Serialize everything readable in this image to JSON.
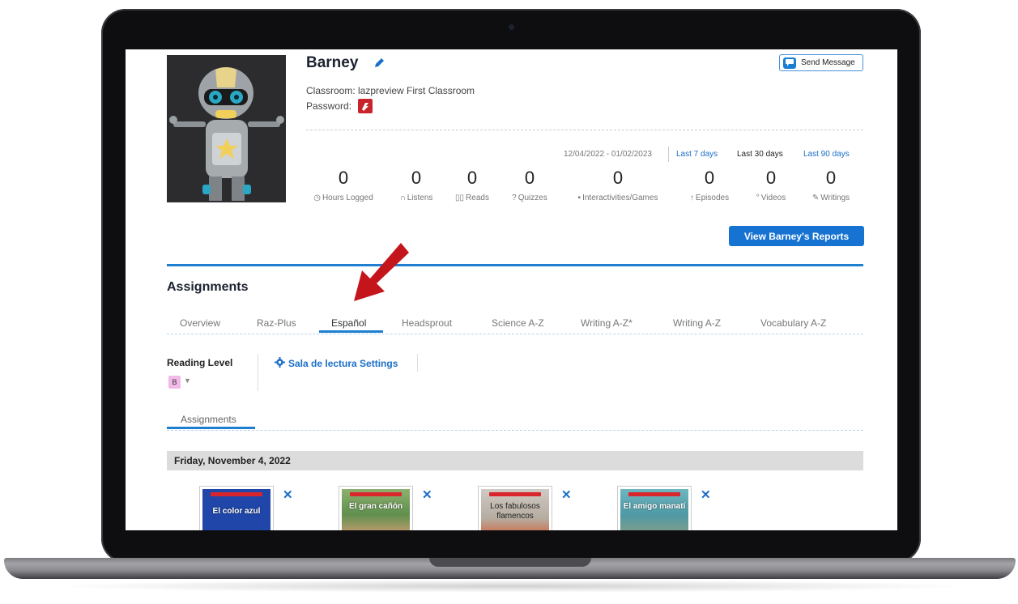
{
  "student": {
    "name": "Barney",
    "classroom": "Classroom: lazpreview First Classroom",
    "password_label": "Password:"
  },
  "send_message_label": "Send Message",
  "date_range": "12/04/2022 - 01/02/2023",
  "ranges": [
    "Last 7 days",
    "Last 30 days",
    "Last 90 days"
  ],
  "selected_range": "Last 30 days",
  "stats": [
    {
      "value": "0",
      "label": "Hours Logged",
      "icon": "clock-icon"
    },
    {
      "value": "0",
      "label": "Listens",
      "icon": "headphones-icon"
    },
    {
      "value": "0",
      "label": "Reads",
      "icon": "book-icon"
    },
    {
      "value": "0",
      "label": "Quizzes",
      "icon": "question-icon"
    },
    {
      "value": "0",
      "label": "Interactivities/Games",
      "icon": "game-icon"
    },
    {
      "value": "0",
      "label": "Episodes",
      "icon": "episodes-icon"
    },
    {
      "value": "0",
      "label": "Videos",
      "icon": "video-icon"
    },
    {
      "value": "0",
      "label": "Writings",
      "icon": "pencil-icon"
    }
  ],
  "reports_button": "View Barney's Reports",
  "assignments_heading": "Assignments",
  "tabs": [
    "Overview",
    "Raz-Plus",
    "Español",
    "Headsprout",
    "Science A-Z",
    "Writing A-Z*",
    "Writing A-Z",
    "Vocabulary A-Z"
  ],
  "active_tab": "Español",
  "reading_level": {
    "label": "Reading Level",
    "value": "B"
  },
  "settings_link": "Sala de lectura Settings",
  "subtab": "Assignments",
  "date_heading": "Friday, November 4, 2022",
  "books": [
    {
      "title": "El color azul",
      "color": "#1f46a8"
    },
    {
      "title": "El gran cañón",
      "color": "#5f8f4e"
    },
    {
      "title": "Los fabulosos flamencos",
      "color": "#b6aca0"
    },
    {
      "title": "El amigo manatí",
      "color": "#4e9aa6"
    }
  ],
  "colors": {
    "accent": "#1e7fd0",
    "button": "#1673d2",
    "arrow": "#c4151c"
  }
}
